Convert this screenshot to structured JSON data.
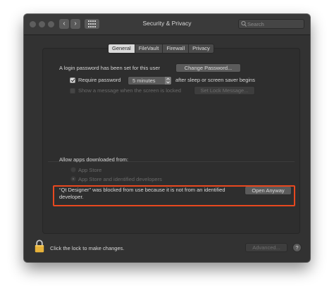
{
  "window": {
    "title": "Security & Privacy",
    "search_placeholder": "Search"
  },
  "tabs": [
    {
      "label": "General",
      "active": true
    },
    {
      "label": "FileVault",
      "active": false
    },
    {
      "label": "Firewall",
      "active": false
    },
    {
      "label": "Privacy",
      "active": false
    }
  ],
  "general": {
    "password_set_text": "A login password has been set for this user",
    "change_password_button": "Change Password...",
    "require_password": {
      "label": "Require password",
      "checked": true,
      "interval": "5 minutes",
      "suffix": "after sleep or screen saver begins"
    },
    "show_message": {
      "label": "Show a message when the screen is locked",
      "checked": false,
      "enabled": false
    },
    "set_lock_message_button": "Set Lock Message..."
  },
  "allow_apps": {
    "heading": "Allow apps downloaded from:",
    "options": [
      {
        "label": "App Store",
        "selected": false,
        "enabled": false
      },
      {
        "label": "App Store and identified developers",
        "selected": true,
        "enabled": false
      }
    ],
    "blocked_message": "“Qt Designer” was blocked from use because it is not from an identified developer.",
    "open_anyway_button": "Open Anyway"
  },
  "footer": {
    "lock_text": "Click the lock to make changes.",
    "advanced_button": "Advanced...",
    "help_button": "?"
  },
  "colors": {
    "highlight_border": "#e8481f",
    "lock_icon": "#e7b23a"
  }
}
